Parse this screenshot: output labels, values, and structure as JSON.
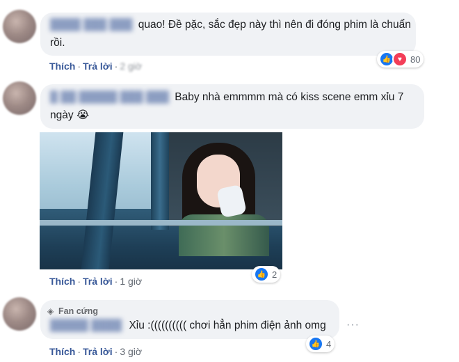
{
  "comments": [
    {
      "text": "quao! Đề pặc, sắc đẹp này thì nên đi đóng phim là chuẩn rồi.",
      "actions": {
        "like": "Thích",
        "reply": "Trả lời",
        "time": "2 giờ"
      },
      "reactions": {
        "types": [
          "like",
          "love"
        ],
        "count": "80"
      }
    },
    {
      "text": "Baby nhà emmmm mà có kiss scene emm xỉu 7 ngày",
      "emoji": "😭",
      "actions": {
        "like": "Thích",
        "reply": "Trả lời",
        "time": "1 giờ"
      },
      "reactions": {
        "types": [
          "like"
        ],
        "count": "2"
      }
    },
    {
      "badge": "Fan cứng",
      "text": "Xỉu :(((((((((( chơi hẳn phim điện ảnh omg",
      "actions": {
        "like": "Thích",
        "reply": "Trả lời",
        "time": "3 giờ"
      },
      "reactions": {
        "types": [
          "like"
        ],
        "count": "4"
      }
    }
  ],
  "colors": {
    "link": "#385898",
    "bubble": "#f0f2f5",
    "like": "#1877f2",
    "love": "#f33e58"
  }
}
